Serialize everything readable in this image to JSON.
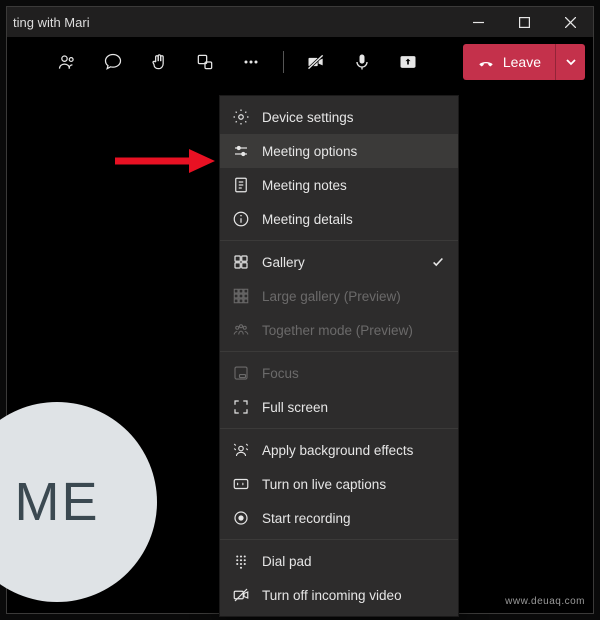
{
  "window": {
    "title": "ting with Mari"
  },
  "toolbar": {
    "leave_label": "Leave"
  },
  "avatar": {
    "initials": "ME"
  },
  "menu": {
    "device_settings": "Device settings",
    "meeting_options": "Meeting options",
    "meeting_notes": "Meeting notes",
    "meeting_details": "Meeting details",
    "gallery": "Gallery",
    "large_gallery": "Large gallery (Preview)",
    "together_mode": "Together mode (Preview)",
    "focus": "Focus",
    "full_screen": "Full screen",
    "apply_bg": "Apply background effects",
    "live_captions": "Turn on live captions",
    "start_recording": "Start recording",
    "dial_pad": "Dial pad",
    "turn_off_incoming": "Turn off incoming video"
  },
  "watermark": "www.deuaq.com"
}
